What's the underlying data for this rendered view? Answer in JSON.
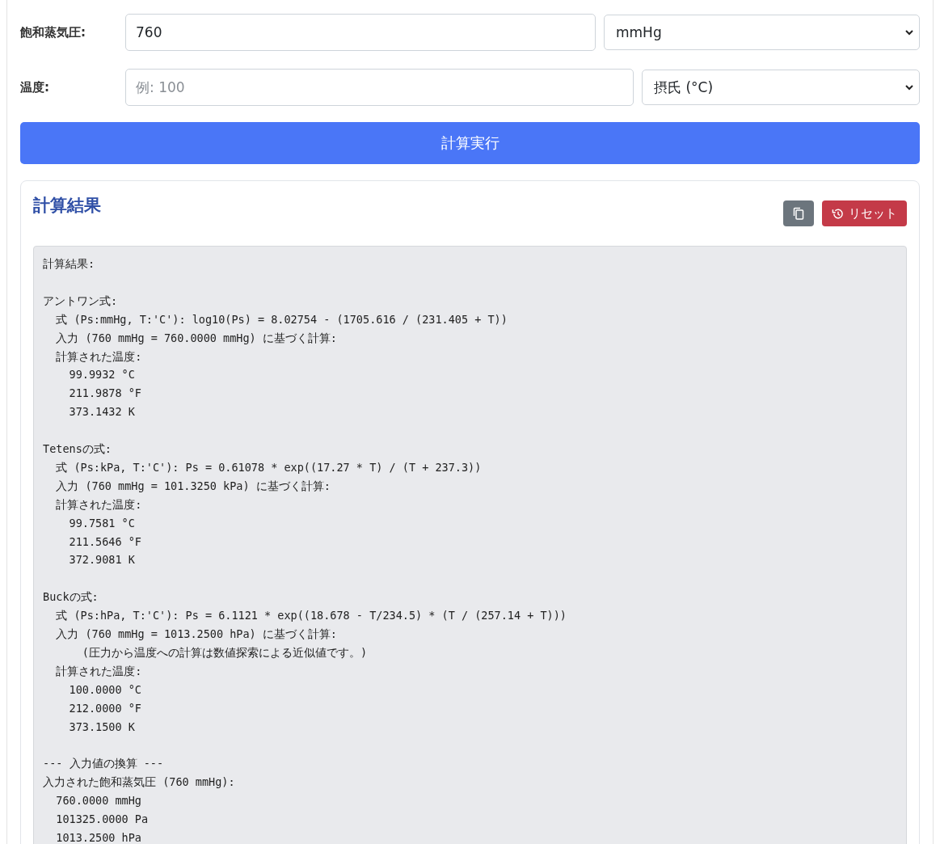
{
  "form": {
    "rows": [
      {
        "label": "飽和蒸気圧:",
        "input": {
          "value": "760"
        },
        "unit": "mmHg"
      },
      {
        "label": "温度:",
        "input": {
          "placeholder": "例: 100"
        },
        "unit": "摂氏 (°C)"
      }
    ],
    "submit": "計算実行"
  },
  "result": {
    "title": "計算結果",
    "reset": "リセット",
    "blocks": [
      [
        "計算結果:"
      ],
      [
        "アントワン式:",
        "  式 (Ps:mmHg, T:'C'): log10(Ps) = 8.02754 - (1705.616 / (231.405 + T))",
        "  入力 (760 mmHg = 760.0000 mmHg) に基づく計算:",
        "  計算された温度:",
        "    99.9932 °C",
        "    211.9878 °F",
        "    373.1432 K"
      ],
      [
        "Tetensの式:",
        "  式 (Ps:kPa, T:'C'): Ps = 0.61078 * exp((17.27 * T) / (T + 237.3))",
        "  入力 (760 mmHg = 101.3250 kPa) に基づく計算:",
        "  計算された温度:",
        "    99.7581 °C",
        "    211.5646 °F",
        "    372.9081 K"
      ],
      [
        "Buckの式:",
        "  式 (Ps:hPa, T:'C'): Ps = 6.1121 * exp((18.678 - T/234.5) * (T / (257.14 + T)))",
        "  入力 (760 mmHg = 1013.2500 hPa) に基づく計算:",
        "      (圧力から温度への計算は数値探索による近似値です。)",
        "  計算された温度:",
        "    100.0000 °C",
        "    212.0000 °F",
        "    373.1500 K"
      ],
      [
        "--- 入力値の換算 ---",
        "入力された飽和蒸気圧 (760 mmHg):",
        "  760.0000 mmHg",
        "  101325.0000 Pa",
        "  1013.2500 hPa"
      ]
    ]
  }
}
